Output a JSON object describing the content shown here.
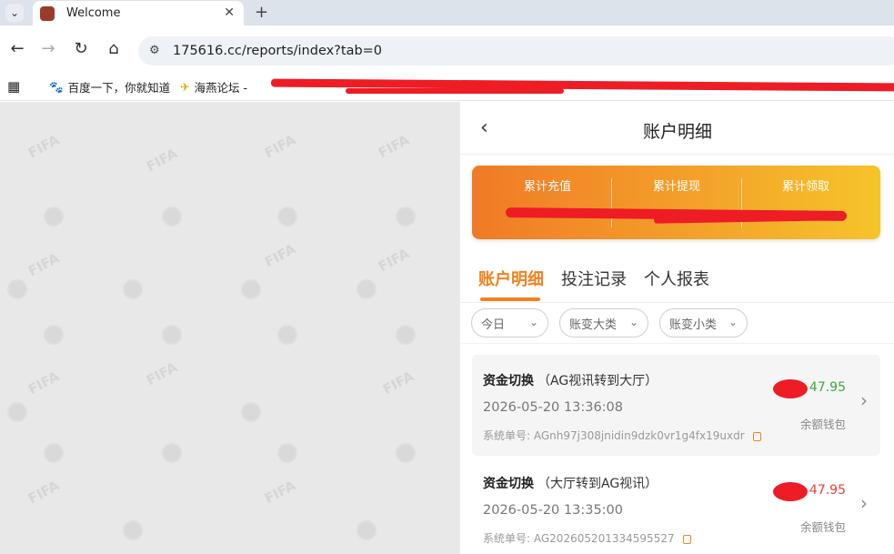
{
  "browser": {
    "tab_title": "Welcome",
    "url": "175616.cc/reports/index?tab=0",
    "bookmarks": [
      "百度一下，你就知道",
      "海燕论坛 -"
    ]
  },
  "page": {
    "title": "账户明细",
    "summary": {
      "labels": [
        "累计充值",
        "累计提现",
        "累计领取"
      ]
    },
    "tabs": [
      "账户明细",
      "投注记录",
      "个人报表"
    ],
    "filters": [
      "今日",
      "账变大类",
      "账变小类"
    ],
    "records": [
      {
        "type": "资金切换",
        "detail": "（AG视讯转到大厅）",
        "time": "2026-05-20 13:36:08",
        "order_label": "系统单号:",
        "order_no": "AGnh97j308jnidin9dzk0vr1g4fx19uxdr",
        "amount": "47.95",
        "amount_color": "#3bab3b",
        "wallet": "余额钱包"
      },
      {
        "type": "资金切换",
        "detail": "（大厅转到AG视讯）",
        "time": "2026-05-20 13:35:00",
        "order_label": "系统单号:",
        "order_no": "AG202605201334595527",
        "amount": "47.95",
        "amount_color": "#e0443a",
        "wallet": "余额钱包"
      }
    ],
    "accent_color": "#f0821e"
  }
}
